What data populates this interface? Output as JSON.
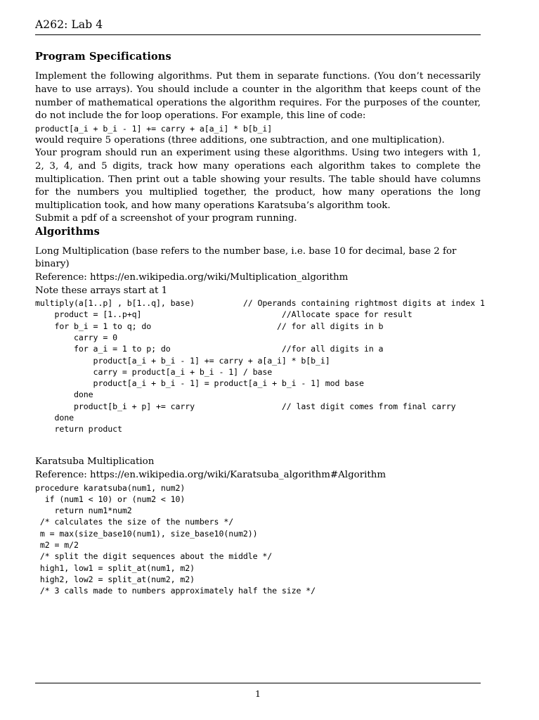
{
  "header": {
    "title": "A262: Lab 4"
  },
  "sections": {
    "specifications": {
      "heading": "Program Specifications",
      "paragraph_1": "Implement the following algorithms. Put them in separate functions. (You don’t necessarily have to use arrays). You should include a counter in the algorithm that keeps count of the number of mathematical operations the algorithm requires. For the purposes of the counter, do not include the for loop operations. For example, this line of code:",
      "example_code": "product[a_i + b_i - 1] += carry + a[a_i] * b[b_i]",
      "paragraph_2": "would require 5 operations (three additions, one subtraction, and one multiplication).",
      "paragraph_3": "Your program should run an experiment using these algorithms. Using two integers with 1, 2, 3, 4, and 5 digits, track how many operations each algorithm takes to complete the multiplication. Then print out a table showing your results. The table should have columns for the numbers you multiplied together, the product, how many operations the long multiplication took, and how many operations Karatsuba’s algorithm took.",
      "paragraph_4": "Submit a pdf of a screenshot of your program running."
    },
    "algorithms": {
      "heading": "Algorithms",
      "long_multiplication": {
        "title": "Long Multiplication (base refers to the number base, i.e. base 10 for decimal, base 2 for binary)",
        "reference": "Reference: https://en.wikipedia.org/wiki/Multiplication_algorithm",
        "note": "Note these arrays start at 1",
        "code": "multiply(a[1..p] , b[1..q], base)          // Operands containing rightmost digits at index 1\n    product = [1..p+q]                             //Allocate space for result\n    for b_i = 1 to q; do                          // for all digits in b\n        carry = 0\n        for a_i = 1 to p; do                       //for all digits in a\n            product[a_i + b_i - 1] += carry + a[a_i] * b[b_i]\n            carry = product[a_i + b_i - 1] / base\n            product[a_i + b_i - 1] = product[a_i + b_i - 1] mod base\n        done\n        product[b_i + p] += carry                  // last digit comes from final carry\n    done\n    return product"
      },
      "karatsuba": {
        "title": "Karatsuba Multiplication",
        "reference": "Reference: https://en.wikipedia.org/wiki/Karatsuba_algorithm#Algorithm",
        "code": "procedure karatsuba(num1, num2)\n  if (num1 < 10) or (num2 < 10)\n    return num1*num2\n /* calculates the size of the numbers */\n m = max(size_base10(num1), size_base10(num2))\n m2 = m/2\n /* split the digit sequences about the middle */\n high1, low1 = split_at(num1, m2)\n high2, low2 = split_at(num2, m2)\n /* 3 calls made to numbers approximately half the size */"
      }
    }
  },
  "footer": {
    "page_number": "1"
  }
}
